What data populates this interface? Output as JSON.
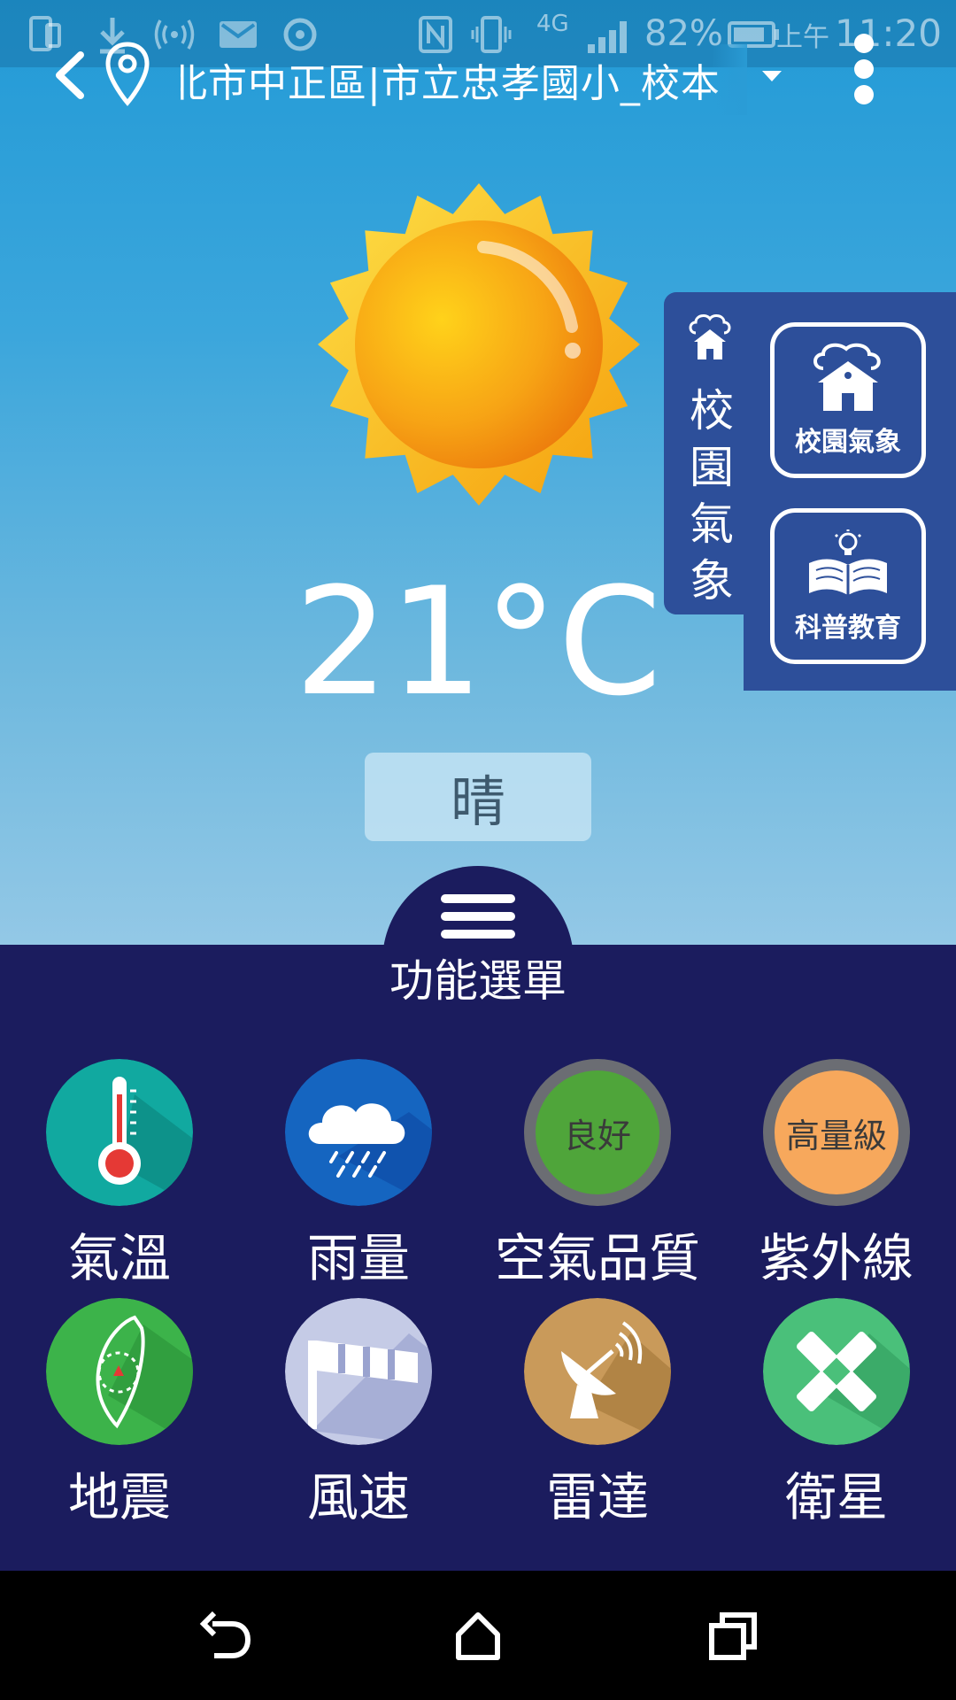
{
  "status_bar": {
    "battery_percent": "82%",
    "network": "4G",
    "ampm": "上午",
    "time": "11:20"
  },
  "app_bar": {
    "location": "北市中正區|市立忠孝國小_校本"
  },
  "weather": {
    "temperature": "21°C",
    "condition": "晴"
  },
  "side_panel": {
    "tab_label_chars": [
      "校",
      "園",
      "氣",
      "象"
    ],
    "buttons": [
      {
        "label": "校園氣象"
      },
      {
        "label": "科普教育"
      }
    ]
  },
  "menu": {
    "title": "功能選單",
    "items": [
      {
        "label": "氣溫"
      },
      {
        "label": "雨量"
      },
      {
        "label": "空氣品質",
        "badge": "良好",
        "badge_color": "#4fa53a"
      },
      {
        "label": "紫外線",
        "badge": "高量級",
        "badge_color": "#f7a85c"
      },
      {
        "label": "地震"
      },
      {
        "label": "風速"
      },
      {
        "label": "雷達"
      },
      {
        "label": "衛星"
      }
    ]
  },
  "colors": {
    "sky_top": "#229ad6",
    "menu_bg": "#1b1c5e",
    "side_panel": "#2d4f9a"
  }
}
